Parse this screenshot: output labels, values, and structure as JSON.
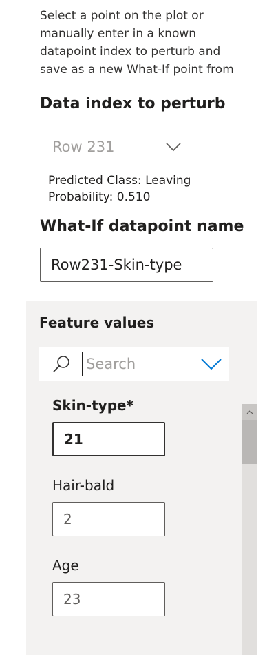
{
  "description": {
    "lines": [
      "Select a point on the plot or",
      "manually enter in a known",
      "datapoint index to perturb and",
      "save as a new What-If point from"
    ]
  },
  "index_section": {
    "heading": "Data index to perturb",
    "dropdown_value": "Row 231",
    "dropdown_icon": "chevron-down-icon"
  },
  "prediction": {
    "class_text": "Predicted Class: Leaving",
    "probability_text": "Probability: 0.510"
  },
  "name_section": {
    "heading": "What-If datapoint name",
    "input_value": "Row231-Skin-type"
  },
  "feature_panel": {
    "heading": "Feature values",
    "search": {
      "placeholder": "Search",
      "value": "",
      "icon": "search-icon",
      "dropdown_icon": "chevron-down-icon"
    },
    "features": [
      {
        "label": "Skin-type*",
        "value": "21",
        "active": true
      },
      {
        "label": "Hair-bald",
        "value": "2",
        "active": false
      },
      {
        "label": "Age",
        "value": "23",
        "active": false
      }
    ]
  },
  "colors": {
    "accent": "#0078d4",
    "panel_bg": "#f3f2f1",
    "placeholder_text": "#a19f9d",
    "border": "#605e5c"
  }
}
